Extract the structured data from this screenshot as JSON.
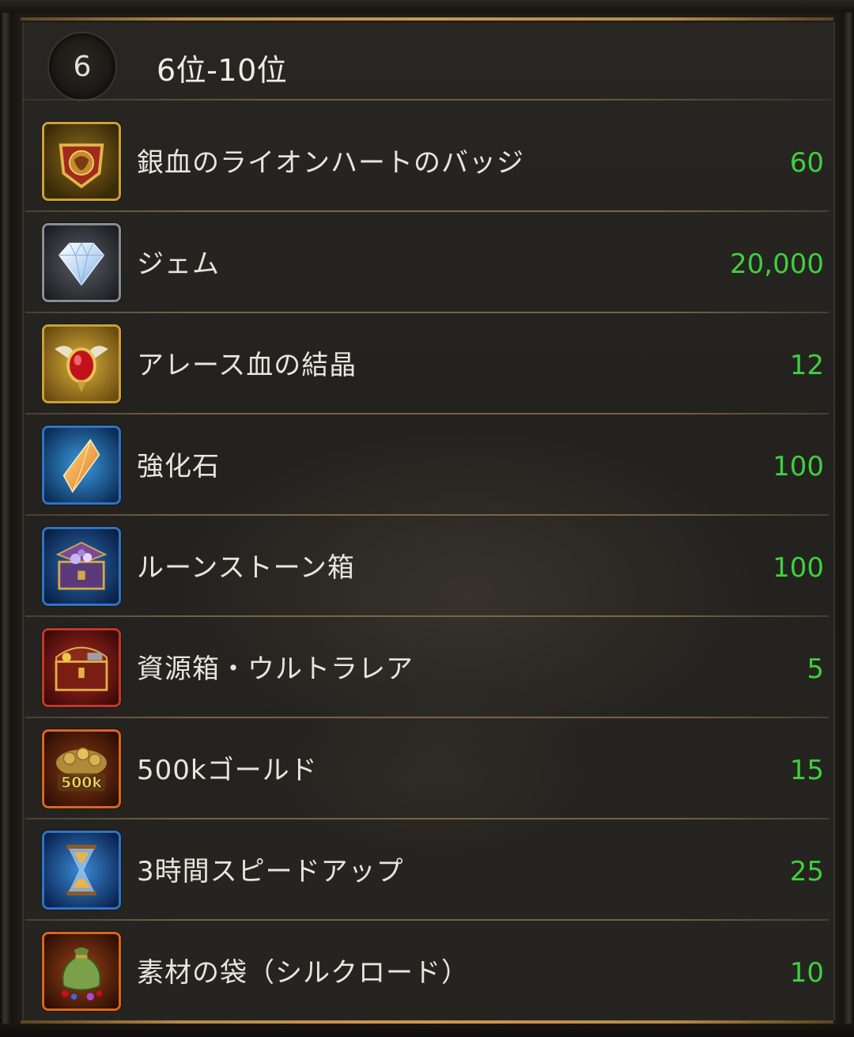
{
  "header": {
    "rank_badge": "6",
    "rank_range": "6位-10位"
  },
  "items": [
    {
      "name": "銀血のライオンハートのバッジ",
      "qty": "60",
      "icon": "lion-badge-icon"
    },
    {
      "name": "ジェム",
      "qty": "20,000",
      "icon": "gem-icon"
    },
    {
      "name": "アレース血の結晶",
      "qty": "12",
      "icon": "blood-crystal-icon"
    },
    {
      "name": "強化石",
      "qty": "100",
      "icon": "enhancement-stone-icon"
    },
    {
      "name": "ルーンストーン箱",
      "qty": "100",
      "icon": "runestone-chest-icon"
    },
    {
      "name": "資源箱・ウルトラレア",
      "qty": "5",
      "icon": "resource-chest-icon"
    },
    {
      "name": "500kゴールド",
      "qty": "15",
      "icon": "gold-pile-icon",
      "icon_label": "500k"
    },
    {
      "name": "3時間スピードアップ",
      "qty": "25",
      "icon": "hourglass-icon"
    },
    {
      "name": "素材の袋（シルクロード）",
      "qty": "10",
      "icon": "material-bag-icon"
    }
  ],
  "colors": {
    "quantity": "#3fcf3f",
    "gold_frame": "#b9922c",
    "blue_frame": "#2f74c4",
    "red_frame": "#c0392b",
    "orange_frame": "#d9661f",
    "silver_frame": "#8a8d92"
  }
}
